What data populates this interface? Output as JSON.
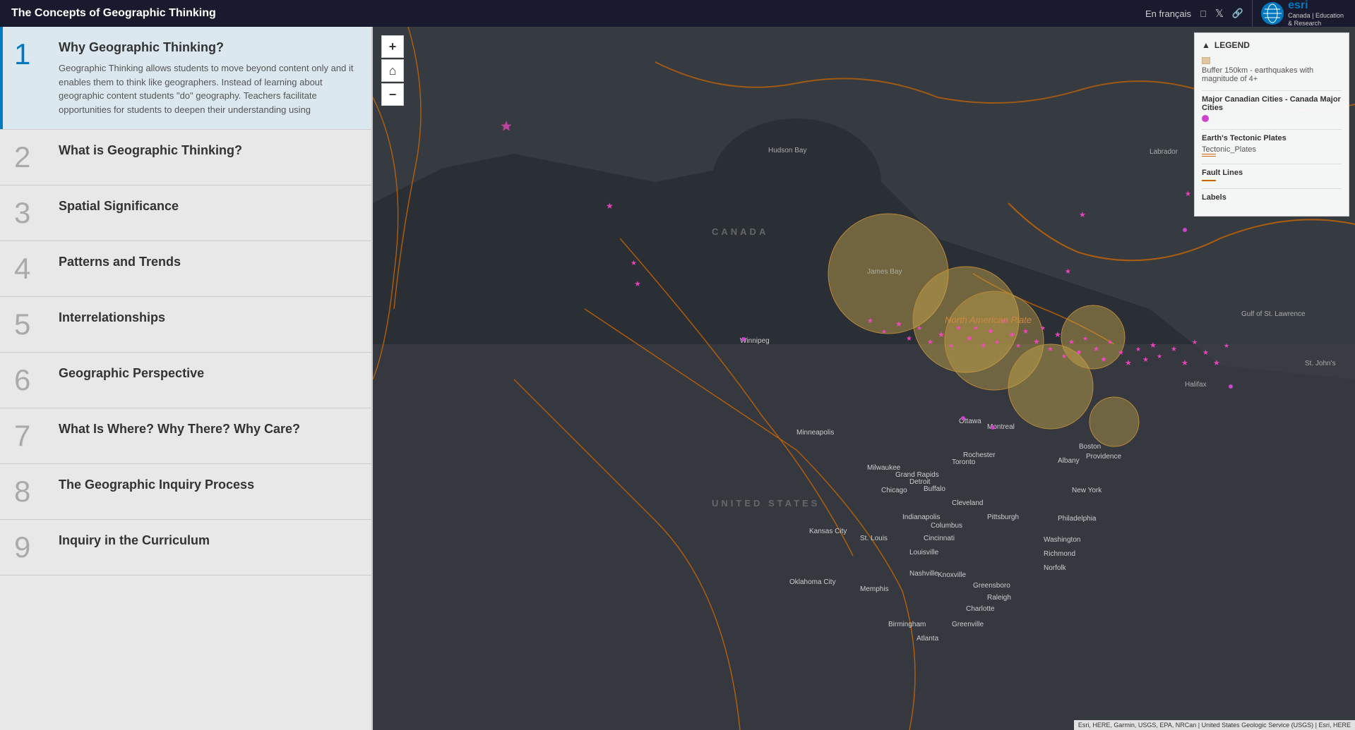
{
  "header": {
    "title": "The Concepts of Geographic Thinking",
    "lang_link": "En français",
    "social_icons": [
      "facebook",
      "twitter",
      "link"
    ],
    "esri_label": "esri",
    "esri_sublabel": "Canada\nEducation\n& Research"
  },
  "sidebar": {
    "items": [
      {
        "number": "1",
        "title": "Why Geographic Thinking?",
        "description": "Geographic Thinking allows students to move beyond content only and it enables them to think like geographers. Instead of learning about geographic content students \"do\" geography. Teachers facilitate opportunities for students to deepen their understanding using",
        "active": true,
        "expanded": true
      },
      {
        "number": "2",
        "title": "What is Geographic Thinking?",
        "description": "",
        "active": false,
        "expanded": false
      },
      {
        "number": "3",
        "title": "Spatial Significance",
        "description": "",
        "active": false,
        "expanded": false
      },
      {
        "number": "4",
        "title": "Patterns and Trends",
        "description": "",
        "active": false,
        "expanded": false
      },
      {
        "number": "5",
        "title": "Interrelationships",
        "description": "",
        "active": false,
        "expanded": false
      },
      {
        "number": "6",
        "title": "Geographic Perspective",
        "description": "",
        "active": false,
        "expanded": false
      },
      {
        "number": "7",
        "title": "What Is Where? Why There? Why Care?",
        "description": "",
        "active": false,
        "expanded": false
      },
      {
        "number": "8",
        "title": "The Geographic Inquiry Process",
        "description": "",
        "active": false,
        "expanded": false
      },
      {
        "number": "9",
        "title": "Inquiry in the Curriculum",
        "description": "",
        "active": false,
        "expanded": false
      }
    ]
  },
  "legend": {
    "title": "LEGEND",
    "sections": [
      {
        "label": "Buffer 150km - earthquakes with magnitude of 4+",
        "type": "polygon",
        "color": "#d4a96a"
      },
      {
        "label": "Major Canadian Cities - Canada Major Cities",
        "type": "point",
        "color": "#cc44cc"
      },
      {
        "label": "Earth's Tectonic Plates",
        "sublabel": "Tectonic_Plates",
        "type": "line-double",
        "color": "#cc6600"
      },
      {
        "label": "Fault Lines",
        "type": "line",
        "color": "#cc6600"
      },
      {
        "label": "Labels",
        "type": "text",
        "color": "#fff"
      }
    ]
  },
  "map": {
    "labels": {
      "canada": "CANADA",
      "united_states": "UNITED STATES",
      "north_american_plate": "North American Plate",
      "hudson_bay": "Hudson Bay",
      "james_bay": "James Bay",
      "gulf_of_st_lawrence": "Gulf of St. Lawrence",
      "winnipeg": "Winnipeg",
      "minneapolis": "Minneapolis",
      "chicago": "Chicago",
      "milwaukee": "Milwaukee",
      "grand_rapids": "Grand Rapids",
      "detroit": "Detroit",
      "cleveland": "Cleveland",
      "toronto": "Toronto",
      "buffalo": "Buffalo",
      "rochester": "Rochester",
      "ottawa": "Ottawa",
      "montreal": "Montreal",
      "albany": "Albany",
      "boston": "Boston",
      "providence": "Providence",
      "new_york": "New York",
      "philadelphia": "Philadelphia",
      "pittsburgh": "Pittsburgh",
      "washington": "Washington",
      "richmond": "Richmond",
      "norfolk": "Norfolk",
      "st_johns": "St. John's",
      "halifax": "Halifax",
      "columbus": "Columbus",
      "indianapolis": "Indianapolis",
      "cincinnati": "Cincinnati",
      "louisville": "Louisville",
      "nashville": "Nashville",
      "st_louis": "St. Louis",
      "kansas_city": "Kansas City",
      "oklahoma_city": "Oklahoma City",
      "memphis": "Memphis",
      "knoxville": "Knoxville",
      "greensboro": "Greensboro",
      "raleigh": "Raleigh",
      "charlotte": "Charlotte",
      "greenville": "Greenville",
      "atlanta": "Atlanta",
      "birmingham": "Birmingham",
      "lu_brador": "Labrador"
    }
  },
  "attribution": "Esri, HERE, Garmin, USGS, EPA, NRCan | United States Geologic Service (USGS) | Esri, HERE"
}
